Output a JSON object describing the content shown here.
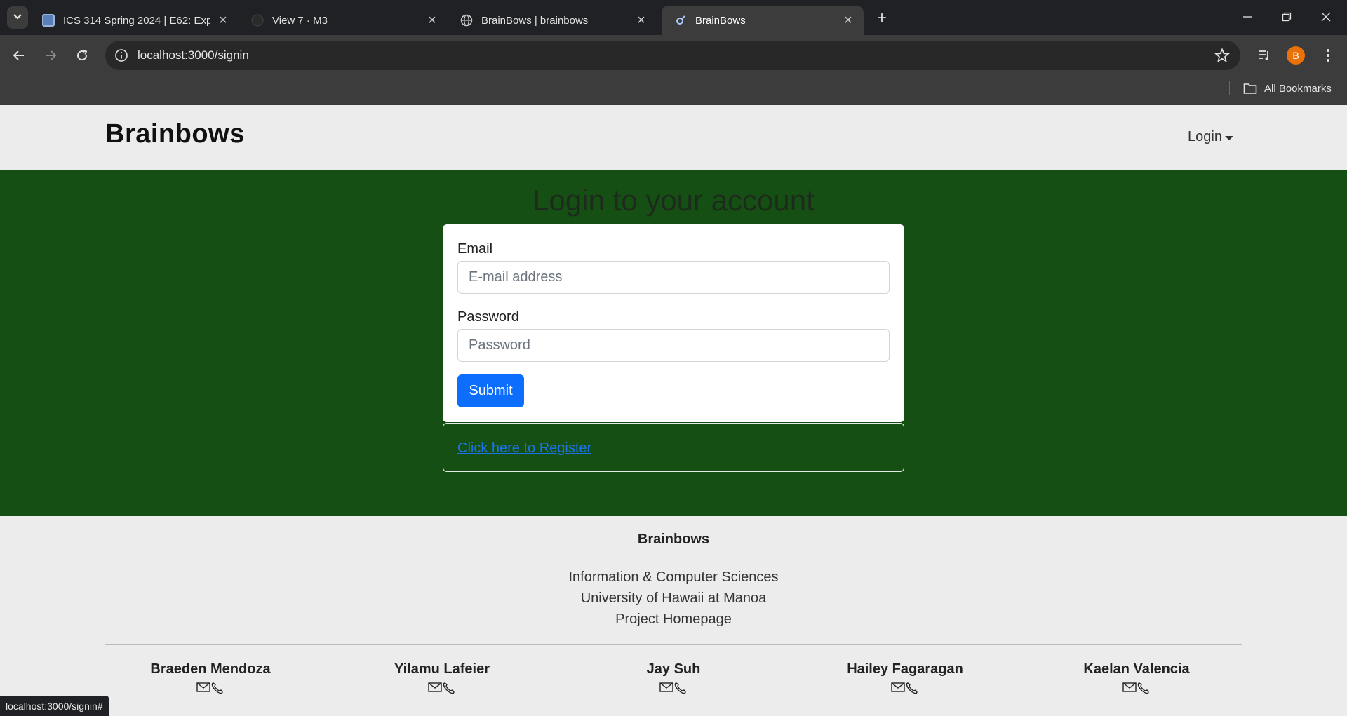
{
  "browser": {
    "tabs": [
      {
        "title": "ICS 314 Spring 2024 | E62: Expe",
        "favicon": "course-icon"
      },
      {
        "title": "View 7 · M3",
        "favicon": "github-icon"
      },
      {
        "title": "BrainBows | brainbows",
        "favicon": "globe-icon"
      },
      {
        "title": "BrainBows",
        "favicon": "meteor-icon"
      }
    ],
    "url": "localhost:3000/signin",
    "profile_initial": "B",
    "bookmarks_label": "All Bookmarks",
    "status_url": "localhost:3000/signin#"
  },
  "navbar": {
    "brand": "Brainbows",
    "login_label": "Login"
  },
  "login": {
    "heading": "Login to your account",
    "email_label": "Email",
    "email_placeholder": "E-mail address",
    "password_label": "Password",
    "password_placeholder": "Password",
    "submit_label": "Submit",
    "register_link": "Click here to Register"
  },
  "footer": {
    "title": "Brainbows",
    "lines": [
      "Information & Computer Sciences",
      "University of Hawaii at Manoa",
      "Project Homepage"
    ],
    "members": [
      "Braeden Mendoza",
      "Yilamu Lafeier",
      "Jay Suh",
      "Hailey Fagaragan",
      "Kaelan Valencia"
    ]
  },
  "colors": {
    "hero_bg": "#164f14",
    "submit_bg": "#0d6efd",
    "profile_bg": "#e8710a"
  }
}
